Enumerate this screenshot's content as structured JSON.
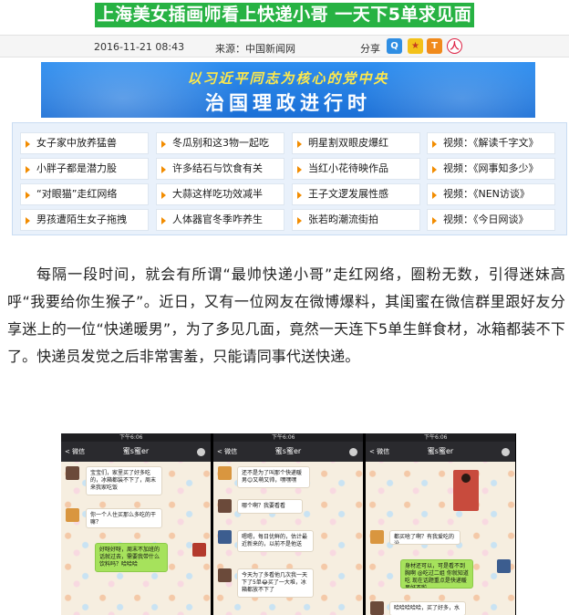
{
  "headline": "上海美女插画师看上快递小哥 一天下5单求见面",
  "meta": {
    "date": "2016-11-21 08:43",
    "source": "来源：中国新闻网",
    "share_label": "分享"
  },
  "share_icons": [
    {
      "name": "qq-share-icon",
      "glyph": "Q"
    },
    {
      "name": "qzone-share-icon",
      "glyph": "★"
    },
    {
      "name": "tencent-weibo-share-icon",
      "glyph": "T"
    },
    {
      "name": "renren-share-icon",
      "glyph": "人"
    }
  ],
  "banner": {
    "line1": "以习近平同志为核心的党中央",
    "line2": "治国理政进行时"
  },
  "links": [
    [
      "女子家中放养猛兽",
      "冬瓜别和这3物一起吃",
      "明星割双眼皮爆红",
      "视频：《解读千字文》"
    ],
    [
      "小胖子都是潜力股",
      "许多结石与饮食有关",
      "当红小花待映作品",
      "视频：《网事知多少》"
    ],
    [
      "“对眼猫”走红网络",
      "大蒜这样吃功效减半",
      "王子文逻发展性感",
      "视频：《NEN访谈》"
    ],
    [
      "男孩遭陌生女子拖拽",
      "人体器官冬季咋养生",
      "张若昀潮流街拍",
      "视频：《今日网谈》"
    ]
  ],
  "article": "每隔一段时间，就会有所谓“最帅快递小哥”走红网络，圈粉无数，引得迷妹高呼“我要给你生猴子”。近日，又有一位网友在微博爆料，其闺蜜在微信群里跟好友分享迷上的一位“快递暖男”，为了多见几面，竟然一天连下5单生鲜食材，冰箱都装不下了。快递员发觉之后非常害羞，只能请同事代送快递。",
  "chat_screens": [
    {
      "status_time": "下午6:06",
      "back": "< 微信",
      "title": "蜜s蜜er",
      "messages": [
        {
          "dir": "in",
          "text": "宝宝们，家里买了好多吃的，冰箱都装不下了，周末来我家吃饭"
        },
        {
          "dir": "in",
          "text": "你一个人住买那么多吃的干嘛？"
        },
        {
          "dir": "out",
          "text": "好呀好呀，周末不加班的话就过去，需要我带什么饮料吗？哈哈哈"
        }
      ]
    },
    {
      "status_time": "下午6:06",
      "back": "< 微信",
      "title": "蜜s蜜er",
      "messages": [
        {
          "dir": "in",
          "text": "还不是为了叫那个快递暖男😊又萌又帅，嘿嘿嘿"
        },
        {
          "dir": "in",
          "text": "哪个啊？我要看看"
        },
        {
          "dir": "in",
          "text": "嗯嗯，每日优鲜的，估计最近新来的，以前不是他送"
        },
        {
          "dir": "in",
          "text": "今天为了多看他几次我一天下了5单😂买了一大堆，冰箱都放不下了"
        }
      ]
    },
    {
      "status_time": "下午6:06",
      "back": "< 微信",
      "title": "蜜s蜜er",
      "messages": [
        {
          "dir": "in",
          "text": "都买啥了啊？有我爱吃的没"
        },
        {
          "dir": "out",
          "text": "身材还可以，可是看不到胸啊 @吃过二姐 你就知道吃 现在话题重点是快递暖男好不啦"
        },
        {
          "dir": "in",
          "text": "哈哈哈哈哈，买了好多，水"
        }
      ]
    }
  ],
  "colors": {
    "headline_bg": "#27b243",
    "banner_bg": "#1b6fd6",
    "banner_line1": "#ffe94a",
    "bullet": "#f28c00",
    "bubble_out": "#a6e25c"
  }
}
